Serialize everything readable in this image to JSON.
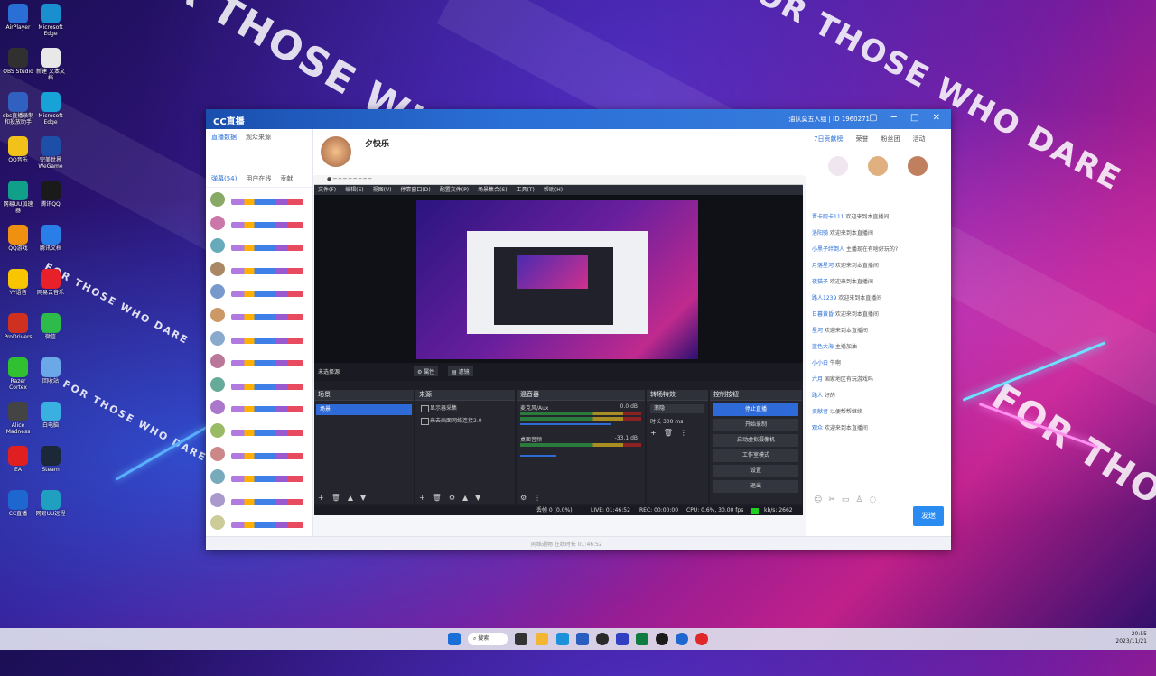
{
  "desktop": {
    "watermark": "FOR THOSE WHO DARE",
    "icons": [
      {
        "label": "AirPlayer",
        "color": "#2a6fd6"
      },
      {
        "label": "Microsoft Edge",
        "color": "#1a8fd0"
      },
      {
        "label": "OBS Studio",
        "color": "#303030"
      },
      {
        "label": "新建 文本文档",
        "color": "#e8e8e8"
      },
      {
        "label": "obs直播录制和投放助手",
        "color": "#3060c0"
      },
      {
        "label": "Microsoft Edge",
        "color": "#17a2d8"
      },
      {
        "label": "QQ音乐",
        "color": "#f2c21b"
      },
      {
        "label": "完美世界 WeGame",
        "color": "#1d4ea8"
      },
      {
        "label": "网易UU加速器",
        "color": "#10a08a"
      },
      {
        "label": "腾讯QQ",
        "color": "#1a1a1a"
      },
      {
        "label": "QQ游戏",
        "color": "#f09010"
      },
      {
        "label": "腾讯文档",
        "color": "#2a7ee8"
      },
      {
        "label": "YY语音",
        "color": "#f7c600"
      },
      {
        "label": "网易云音乐",
        "color": "#e8202a"
      },
      {
        "label": "ProDrivers",
        "color": "#d03020"
      },
      {
        "label": "微信",
        "color": "#2dbb4a"
      },
      {
        "label": "Razer Cortex",
        "color": "#30c030"
      },
      {
        "label": "回收站",
        "color": "#6aa8e8"
      },
      {
        "label": "Alice Madness",
        "color": "#444"
      },
      {
        "label": "白电脑",
        "color": "#3ab0e0"
      },
      {
        "label": "EA",
        "color": "#e02020"
      },
      {
        "label": "Steam",
        "color": "#1b2838"
      },
      {
        "label": "CC直播",
        "color": "#1e66d0"
      },
      {
        "label": "网易UU远程",
        "color": "#20a0c0"
      }
    ]
  },
  "app": {
    "name": "CC直播",
    "top_user": "油队莫五人组",
    "top_info": "ID 1960271",
    "anchor_name": "夕快乐",
    "left_tabs": [
      "弹幕(54)",
      "用户在线",
      "贡献"
    ],
    "left_header": [
      "直播数据",
      "观众来源"
    ],
    "right_tabs": [
      "7日贡献榜",
      "荣誉",
      "粉丝团",
      "活动"
    ],
    "chat": [
      {
        "user": "晋卡阿卡111",
        "text": "欢迎来到本直播间"
      },
      {
        "user": "洛阳骑",
        "text": "欢迎来到本直播间"
      },
      {
        "user": "小黑子绊倒人",
        "text": "主播现在有啥好玩的?"
      },
      {
        "user": "月落星河",
        "text": "欢迎来到本直播间"
      },
      {
        "user": "夜猫子",
        "text": "欢迎来到本直播间"
      },
      {
        "user": "路人1239",
        "text": "欢迎来到本直播间"
      },
      {
        "user": "日暮黄昏",
        "text": "欢迎来到本直播间"
      },
      {
        "user": "星河",
        "text": "欢迎来到本直播间"
      },
      {
        "user": "蓝色大海",
        "text": "主播加油"
      },
      {
        "user": "小小白",
        "text": "牛啊"
      },
      {
        "user": "六月",
        "text": "国家地区有玩游戏吗"
      },
      {
        "user": "路人",
        "text": "好的"
      },
      {
        "user": "贡献者",
        "text": "以便帮帮继续"
      },
      {
        "user": "观众",
        "text": "欢迎来到本直播间"
      }
    ],
    "send_label": "发送",
    "status_text": "网络通畅 在线时长 01:46:52"
  },
  "obs": {
    "menu": [
      "文件(F)",
      "编辑(E)",
      "视图(V)",
      "停靠窗口(D)",
      "配置文件(P)",
      "场景集合(S)",
      "工具(T)",
      "帮助(H)"
    ],
    "no_source": "未选择源",
    "props_label": "属性",
    "filters_label": "滤镜",
    "docks": {
      "scenes": "场景",
      "sources": "来源",
      "mixer": "混音器",
      "transitions": "转场特效",
      "controls": "控制按钮"
    },
    "scene_items": [
      "场景"
    ],
    "source_items": [
      "显示器采集",
      "来去画面网络连接2.0"
    ],
    "mixer": [
      {
        "name": "麦克风/Aux",
        "db": "0.0 dB"
      },
      {
        "name": "桌面音频",
        "db": "-33.1 dB"
      }
    ],
    "transition": {
      "type": "渐隐",
      "duration_label": "时长",
      "duration": "300 ms"
    },
    "controls": [
      "停止直播",
      "开始录制",
      "启动虚拟摄像机",
      "工作室模式",
      "设置",
      "退出"
    ],
    "status": {
      "dropped": "丢帧 0 (0.0%)",
      "live": "LIVE: 01:46:52",
      "rec": "REC: 00:00:00",
      "cpu": "CPU: 0.6%, 30.00 fps",
      "bitrate": "kb/s: 2662"
    }
  },
  "taskbar": {
    "search": "搜索",
    "time": "20:55",
    "date": "2023/11/21"
  }
}
